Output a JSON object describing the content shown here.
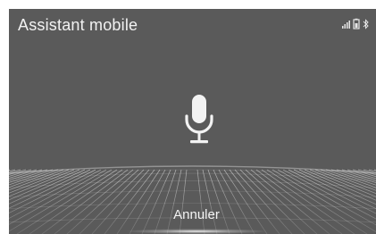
{
  "header": {
    "title": "Assistant mobile"
  },
  "status_icons": [
    "signal-strength-icon",
    "battery-icon",
    "bluetooth-icon"
  ],
  "main": {
    "mic_icon": "microphone-icon"
  },
  "footer": {
    "cancel_label": "Annuler"
  },
  "colors": {
    "background": "#5a5a5a",
    "text": "#f2f2f2"
  }
}
